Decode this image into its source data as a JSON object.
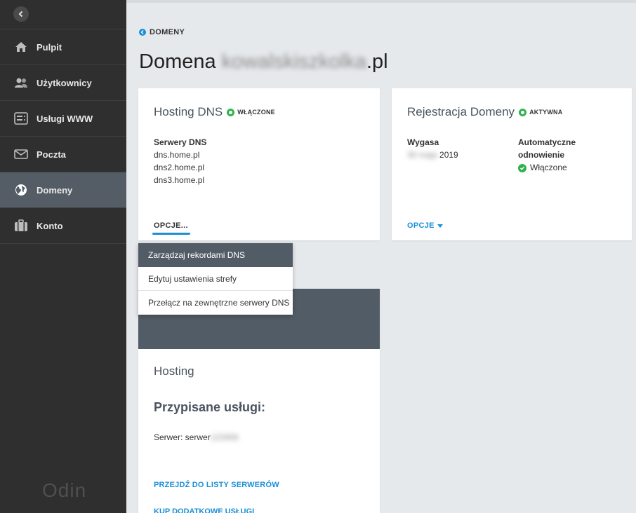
{
  "sidebar": {
    "items": [
      {
        "label": "Pulpit",
        "icon": "home-icon"
      },
      {
        "label": "Użytkownicy",
        "icon": "users-icon"
      },
      {
        "label": "Usługi WWW",
        "icon": "server-icon"
      },
      {
        "label": "Poczta",
        "icon": "mail-icon"
      },
      {
        "label": "Domeny",
        "icon": "globe-icon",
        "active": true
      },
      {
        "label": "Konto",
        "icon": "briefcase-icon"
      }
    ],
    "logo": "Odin"
  },
  "breadcrumb": {
    "label": "DOMENY"
  },
  "page": {
    "title_prefix": "Domena ",
    "title_blurred": "kowalskiszkolka",
    "title_suffix": ".pl"
  },
  "dns_card": {
    "title": "Hosting DNS",
    "status": "WŁĄCZONE",
    "servers_label": "Serwery DNS",
    "servers": [
      "dns.home.pl",
      "dns2.home.pl",
      "dns3.home.pl"
    ],
    "options_label": "OPCJE..."
  },
  "reg_card": {
    "title": "Rejestracja Domeny",
    "status": "AKTYWNA",
    "expires_label": "Wygasa",
    "expires_blurred": "30 maja ",
    "expires_year": "2019",
    "auto_label_1": "Automatyczne",
    "auto_label_2": "odnowienie",
    "auto_value": "Włączone",
    "options_label": "OPCJE"
  },
  "dropdown": {
    "items": [
      "Zarządzaj rekordami DNS",
      "Edytuj ustawienia strefy",
      "Przełącz na zewnętrzne serwery DNS"
    ]
  },
  "hosting_card": {
    "title": "Hosting",
    "subtitle": "Przypisane usługi:",
    "server_label": "Serwer: serwer",
    "server_blurred": "123456",
    "link": "PRZEJDŹ DO LISTY SERWERÓW",
    "link2": "KUP DODATKOWE USŁUGI"
  },
  "colors": {
    "accent": "#1a8fd6",
    "success": "#2fb34a",
    "sidebar": "#2f2f2f",
    "active": "#545d66"
  }
}
